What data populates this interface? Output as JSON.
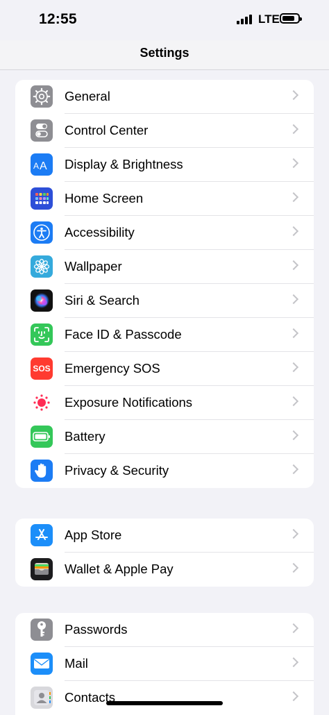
{
  "status": {
    "time": "12:55",
    "network": "LTE"
  },
  "nav": {
    "title": "Settings"
  },
  "groups": [
    {
      "items": [
        {
          "label": "General",
          "icon": "gear-icon",
          "color": "#8e8e93"
        },
        {
          "label": "Control Center",
          "icon": "toggles-icon",
          "color": "#8e8e93"
        },
        {
          "label": "Display & Brightness",
          "icon": "text-size-icon",
          "color": "#1c7cf4"
        },
        {
          "label": "Home Screen",
          "icon": "app-grid-icon",
          "color": "#2d4fd8"
        },
        {
          "label": "Accessibility",
          "icon": "accessibility-icon",
          "color": "#1c7cf4"
        },
        {
          "label": "Wallpaper",
          "icon": "flower-icon",
          "color": "#35aadc"
        },
        {
          "label": "Siri & Search",
          "icon": "siri-icon",
          "color": "#1a1a2e"
        },
        {
          "label": "Face ID & Passcode",
          "icon": "face-id-icon",
          "color": "#34c759"
        },
        {
          "label": "Emergency SOS",
          "icon": "sos-icon",
          "color": "#ff3b30",
          "icon_text": "SOS"
        },
        {
          "label": "Exposure Notifications",
          "icon": "exposure-icon",
          "color": "#ffffff"
        },
        {
          "label": "Battery",
          "icon": "battery-icon",
          "color": "#34c759"
        },
        {
          "label": "Privacy & Security",
          "icon": "hand-icon",
          "color": "#1c7cf4"
        }
      ]
    },
    {
      "items": [
        {
          "label": "App Store",
          "icon": "app-store-icon",
          "color": "#1c8ef9"
        },
        {
          "label": "Wallet & Apple Pay",
          "icon": "wallet-icon",
          "color": "#1c1c1e"
        }
      ]
    },
    {
      "items": [
        {
          "label": "Passwords",
          "icon": "key-icon",
          "color": "#8e8e93"
        },
        {
          "label": "Mail",
          "icon": "mail-icon",
          "color": "#1c8ef9"
        },
        {
          "label": "Contacts",
          "icon": "contacts-icon",
          "color": "#d8d8dc"
        }
      ]
    }
  ]
}
